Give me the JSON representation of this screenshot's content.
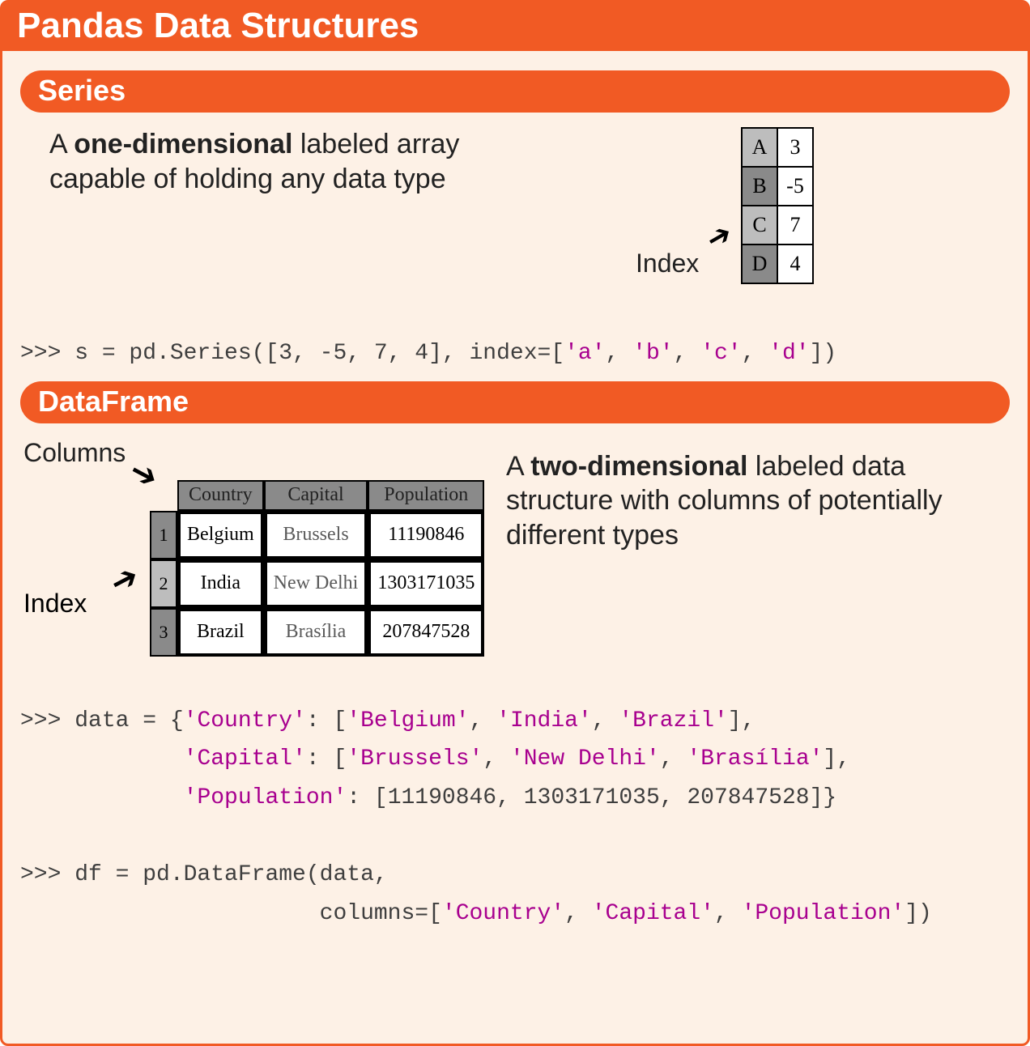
{
  "main_title": "Pandas Data Structures",
  "series": {
    "heading": "Series",
    "desc_prefix": "A ",
    "desc_bold": "one-dimensional",
    "desc_rest": " labeled array capable of holding any data type",
    "index_label": "Index",
    "table": [
      {
        "idx": "A",
        "val": "3"
      },
      {
        "idx": "B",
        "val": "-5"
      },
      {
        "idx": "C",
        "val": "7"
      },
      {
        "idx": "D",
        "val": "4"
      }
    ],
    "code_parts": {
      "p1": ">>> s = pd.Series([3, -5, 7, 4], index=[",
      "s1": "'a'",
      "c": ", ",
      "s2": "'b'",
      "s3": "'c'",
      "s4": "'d'",
      "p2": "])"
    }
  },
  "dataframe": {
    "heading": "DataFrame",
    "columns_label": "Columns",
    "index_label": "Index",
    "headers": [
      "Country",
      "Capital",
      "Population"
    ],
    "rows": [
      {
        "i": "1",
        "c1": "Belgium",
        "c2": "Brussels",
        "c3": "11190846"
      },
      {
        "i": "2",
        "c1": "India",
        "c2": "New Delhi",
        "c3": "1303171035"
      },
      {
        "i": "3",
        "c1": "Brazil",
        "c2": "Brasília",
        "c3": "207847528"
      }
    ],
    "desc_prefix": "A ",
    "desc_bold": "two-dimensional",
    "desc_rest": " labeled data structure with columns of potentially different types",
    "code": {
      "l1a": ">>> data = {",
      "l1s1": "'Country'",
      "l1b": ": [",
      "l1s2": "'Belgium'",
      "l1c": ", ",
      "l1s3": "'India'",
      "l1s4": "'Brazil'",
      "l1d": "],",
      "l2pad": "            ",
      "l2s1": "'Capital'",
      "l2a": ": [",
      "l2s2": "'Brussels'",
      "l2s3": "'New Delhi'",
      "l2s4": "'Brasília'",
      "l2b": "],",
      "l3pad": "            ",
      "l3s1": "'Population'",
      "l3a": ": [11190846, 1303171035, 207847528]}",
      "l4": ">>> df = pd.DataFrame(data,",
      "l5pad": "                      columns=[",
      "l5s1": "'Country'",
      "l5s2": "'Capital'",
      "l5s3": "'Population'",
      "l5b": "])"
    }
  }
}
